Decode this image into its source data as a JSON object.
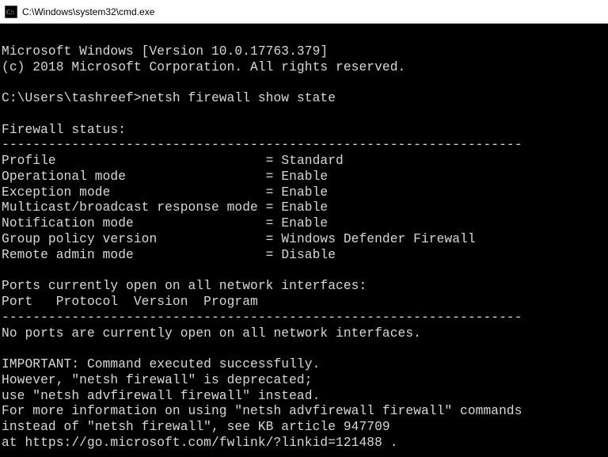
{
  "window": {
    "title_path": "C:\\Windows\\system32\\cmd.exe",
    "icon": "cmd-icon"
  },
  "terminal": {
    "banner_line1": "Microsoft Windows [Version 10.0.17763.379]",
    "banner_line2": "(c) 2018 Microsoft Corporation. All rights reserved.",
    "prompt": "C:\\Users\\tashreef>",
    "command": "netsh firewall show state",
    "status_heading": "Firewall status:",
    "sep": "-------------------------------------------------------------------",
    "rows": [
      {
        "label": "Profile                           =",
        "value": "Standard"
      },
      {
        "label": "Operational mode                  =",
        "value": "Enable"
      },
      {
        "label": "Exception mode                    =",
        "value": "Enable"
      },
      {
        "label": "Multicast/broadcast response mode =",
        "value": "Enable"
      },
      {
        "label": "Notification mode                 =",
        "value": "Enable"
      },
      {
        "label": "Group policy version              =",
        "value": "Windows Defender Firewall"
      },
      {
        "label": "Remote admin mode                 =",
        "value": "Disable"
      }
    ],
    "ports_heading": "Ports currently open on all network interfaces:",
    "ports_columns": "Port   Protocol  Version  Program",
    "no_ports": "No ports are currently open on all network interfaces.",
    "important1": "IMPORTANT: Command executed successfully.",
    "important2": "However, \"netsh firewall\" is deprecated;",
    "important3": "use \"netsh advfirewall firewall\" instead.",
    "important4": "For more information on using \"netsh advfirewall firewall\" commands",
    "important5": "instead of \"netsh firewall\", see KB article 947709",
    "important6": "at https://go.microsoft.com/fwlink/?linkid=121488 ."
  }
}
